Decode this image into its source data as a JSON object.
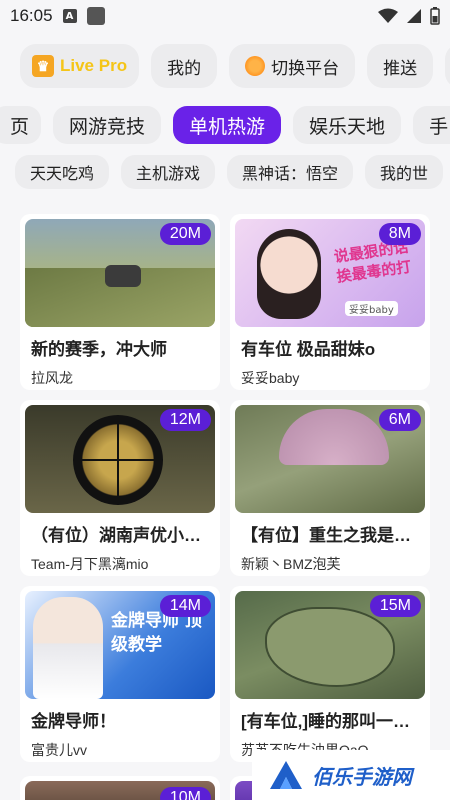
{
  "status_bar": {
    "time": "16:05",
    "notification_letter": "A"
  },
  "platform_chips": [
    {
      "label": "Live Pro",
      "type": "livepro"
    },
    {
      "label": "我的",
      "type": "plain"
    },
    {
      "label": "切换平台",
      "type": "switch"
    },
    {
      "label": "推送",
      "type": "plain"
    }
  ],
  "category_tabs": [
    {
      "label": "页",
      "active": false
    },
    {
      "label": "网游竞技",
      "active": false
    },
    {
      "label": "单机热游",
      "active": true
    },
    {
      "label": "娱乐天地",
      "active": false
    },
    {
      "label": "手",
      "active": false
    }
  ],
  "sub_tags": [
    "天天吃鸡",
    "主机游戏",
    "黑神话：悟空",
    "我的世"
  ],
  "streams": [
    {
      "viewers": "20M",
      "title": "新的赛季，冲大师",
      "author": "拉风龙"
    },
    {
      "viewers": "8M",
      "title": "有车位 极品甜妹o",
      "author": "妥妥baby",
      "thumb_text": "说最狠的话 挨最毒的打",
      "thumb_caption": "妥妥baby"
    },
    {
      "viewers": "12M",
      "title": "（有位）湖南声优小改改",
      "author": "Team-月下黑漓mio"
    },
    {
      "viewers": "6M",
      "title": "【有位】重生之我是女...",
      "author": "新颖丶BMZ泡芙"
    },
    {
      "viewers": "14M",
      "title": "金牌导师！",
      "author": "富贵儿vv",
      "thumb_text": "金牌导师 顶级教学"
    },
    {
      "viewers": "15M",
      "title": "[有车位,]睡的那叫一个...",
      "author": "苏苏不吃牛油果QaQ"
    }
  ],
  "partial_streams": [
    {
      "viewers": "10M"
    }
  ],
  "watermark": {
    "text": "佰乐手游网"
  },
  "colors": {
    "accent": "#6a22e8",
    "badge": "#5b1fd6",
    "chip_bg": "#ececee",
    "watermark_blue": "#1f5fc9"
  }
}
